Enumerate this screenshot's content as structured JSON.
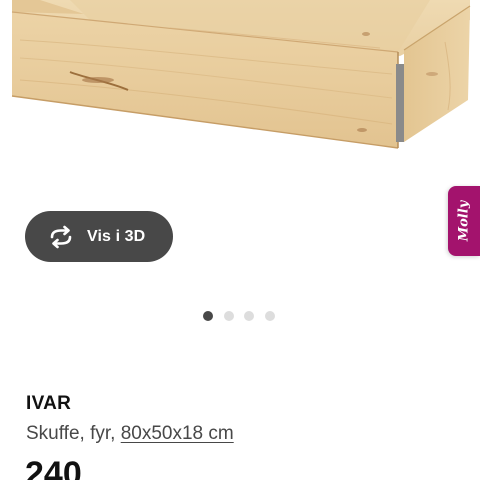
{
  "product": {
    "image_alt": "IVAR skuff",
    "view_3d_label": "Vis i 3D",
    "view_3d_icon": "rotate-3d-icon",
    "name": "IVAR",
    "description_prefix": "Skuffe, fyr,",
    "measurements": "80x50x18 cm",
    "price": "240"
  },
  "carousel": {
    "total_slides": 4,
    "active_index": 0
  },
  "molly": {
    "label": "Molly",
    "color": "#a3136d"
  },
  "colors": {
    "pill_background": "#484848",
    "dot_inactive": "#dddddd",
    "dot_active": "#484848"
  }
}
